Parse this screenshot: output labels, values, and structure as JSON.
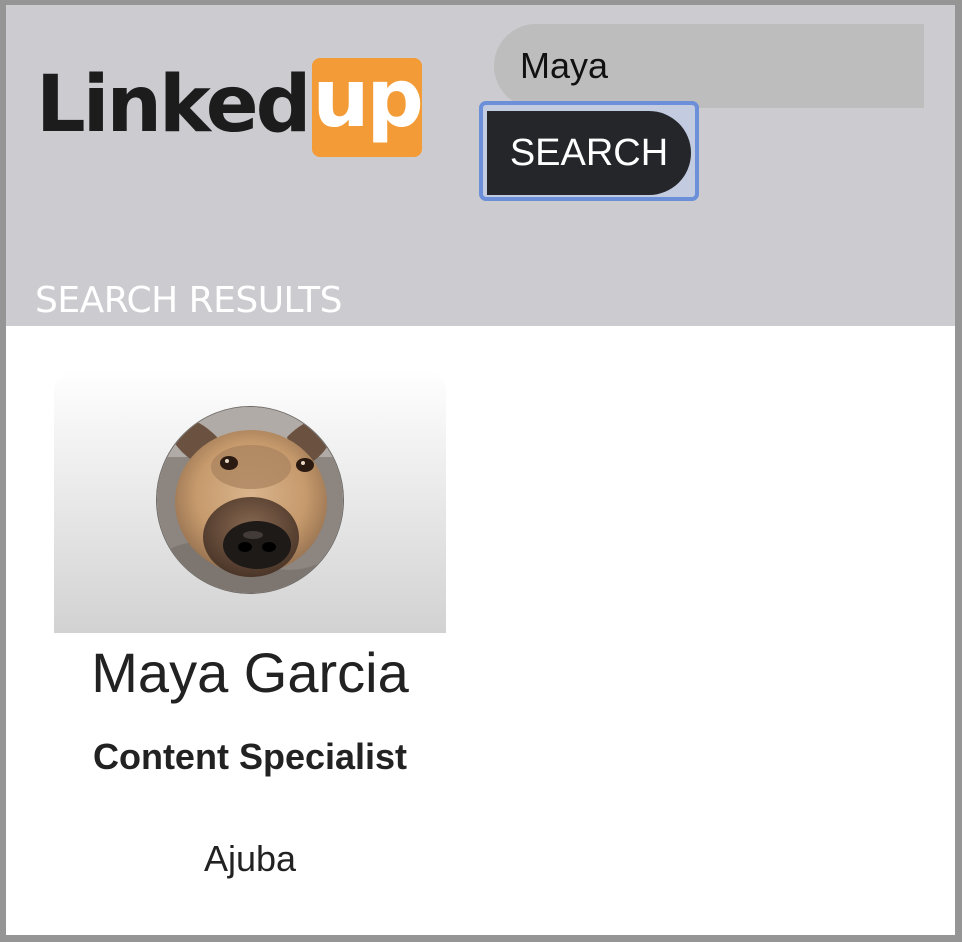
{
  "header": {
    "logo": {
      "part1": "Linked",
      "part2": "up",
      "accent_color": "#f39c37"
    },
    "search": {
      "value": "Maya",
      "button_label": "SEARCH"
    },
    "results_heading": "SEARCH RESULTS",
    "background_color": "#cbcbd0"
  },
  "results": [
    {
      "name": "Maya Garcia",
      "title": "Content Specialist",
      "company": "Ajuba",
      "avatar_icon": "dog-photo-avatar"
    }
  ]
}
